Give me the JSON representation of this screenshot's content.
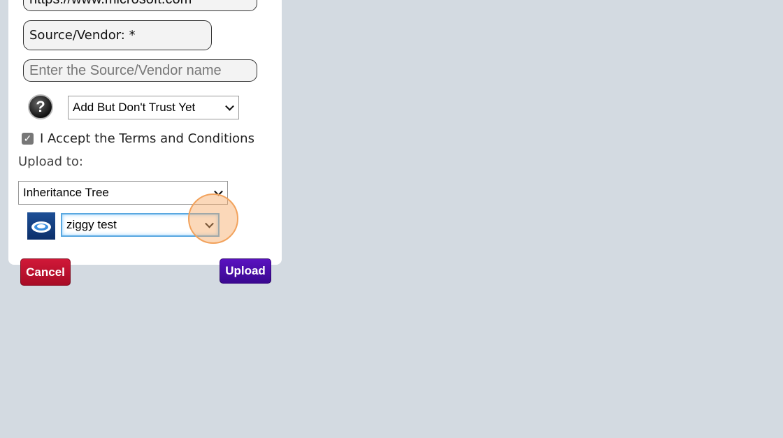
{
  "form": {
    "url_value": "https://www.microsoft.com",
    "source_label": "Source/Vendor: *",
    "source_placeholder": "Enter the Source/Vendor name",
    "trust_select": "Add But Don't Trust Yet",
    "terms_label": "I Accept the Terms and Conditions",
    "terms_checked": true,
    "upload_to_label": "Upload to:",
    "destination_select": "Inheritance Tree",
    "tree_select": "ziggy test"
  },
  "buttons": {
    "cancel": "Cancel",
    "upload": "Upload"
  },
  "colors": {
    "cancel": "#c0102e",
    "upload": "#4a0aa8",
    "background": "#d3dae1",
    "click_indicator": "#f7a863"
  },
  "icons": {
    "help": "help-question-icon",
    "tree": "cloud-tree-icon"
  }
}
